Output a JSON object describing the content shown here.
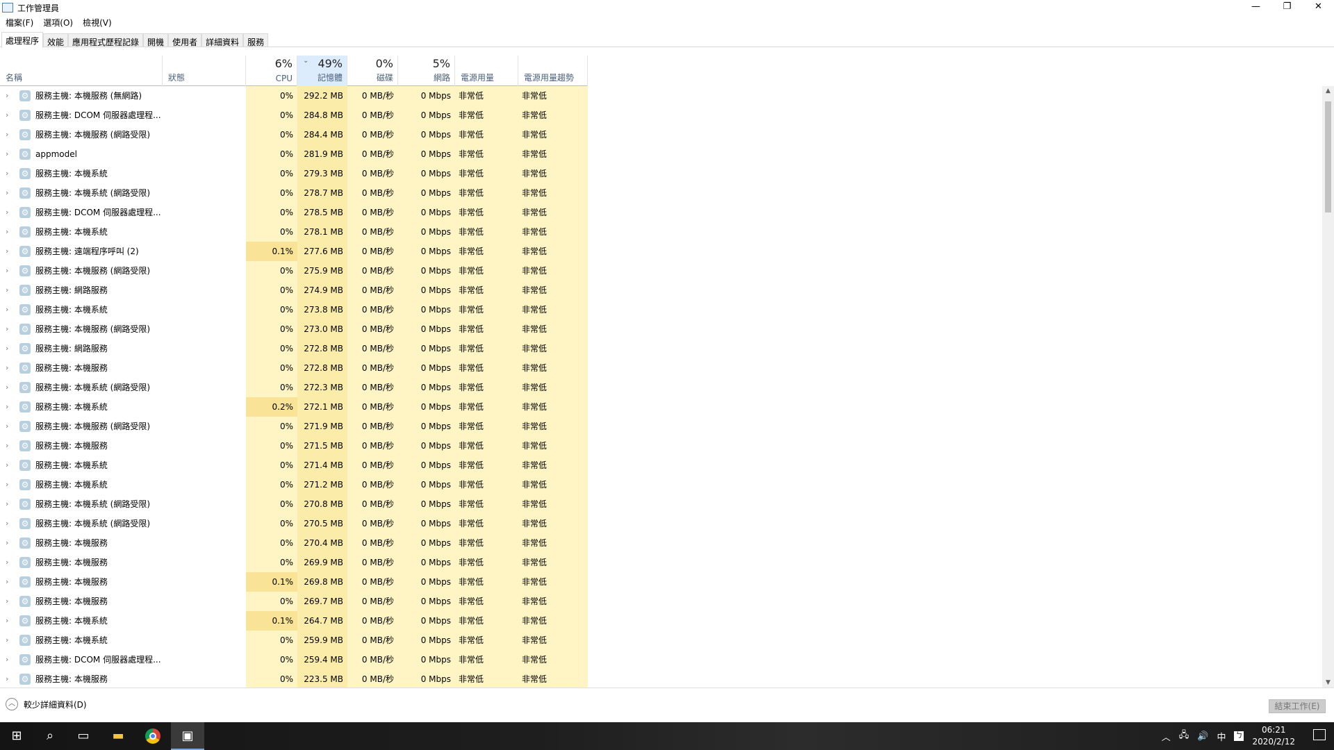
{
  "window": {
    "title": "工作管理員",
    "minimize": "—",
    "maximize": "❐",
    "close": "✕"
  },
  "menu": [
    "檔案(F)",
    "選項(O)",
    "檢視(V)"
  ],
  "tabs": [
    "處理程序",
    "效能",
    "應用程式歷程記錄",
    "開機",
    "使用者",
    "詳細資料",
    "服務"
  ],
  "columns": {
    "name": "名稱",
    "status": "狀態",
    "cpu_pct": "6%",
    "cpu": "CPU",
    "mem_pct": "49%",
    "mem": "記憶體",
    "disk_pct": "0%",
    "disk": "磁碟",
    "net_pct": "5%",
    "net": "網路",
    "power": "電源用量",
    "power_trend": "電源用量趨勢"
  },
  "rows": [
    [
      "服務主機: 本機服務 (無網路)",
      "0%",
      "292.2 MB"
    ],
    [
      "服務主機: DCOM 伺服器處理程...",
      "0%",
      "284.8 MB"
    ],
    [
      "服務主機: 本機服務 (網路受限)",
      "0%",
      "284.4 MB"
    ],
    [
      "appmodel",
      "0%",
      "281.9 MB"
    ],
    [
      "服務主機: 本機系統",
      "0%",
      "279.3 MB"
    ],
    [
      "服務主機: 本機系統 (網路受限)",
      "0%",
      "278.7 MB"
    ],
    [
      "服務主機: DCOM 伺服器處理程...",
      "0%",
      "278.5 MB"
    ],
    [
      "服務主機: 本機系統",
      "0%",
      "278.1 MB"
    ],
    [
      "服務主機: 遠端程序呼叫 (2)",
      "0.1%",
      "277.6 MB"
    ],
    [
      "服務主機: 本機服務 (網路受限)",
      "0%",
      "275.9 MB"
    ],
    [
      "服務主機: 網路服務",
      "0%",
      "274.9 MB"
    ],
    [
      "服務主機: 本機系統",
      "0%",
      "273.8 MB"
    ],
    [
      "服務主機: 本機服務 (網路受限)",
      "0%",
      "273.0 MB"
    ],
    [
      "服務主機: 網路服務",
      "0%",
      "272.8 MB"
    ],
    [
      "服務主機: 本機服務",
      "0%",
      "272.8 MB"
    ],
    [
      "服務主機: 本機系統 (網路受限)",
      "0%",
      "272.3 MB"
    ],
    [
      "服務主機: 本機系統",
      "0.2%",
      "272.1 MB"
    ],
    [
      "服務主機: 本機服務 (網路受限)",
      "0%",
      "271.9 MB"
    ],
    [
      "服務主機: 本機服務",
      "0%",
      "271.5 MB"
    ],
    [
      "服務主機: 本機系統",
      "0%",
      "271.4 MB"
    ],
    [
      "服務主機: 本機系統",
      "0%",
      "271.2 MB"
    ],
    [
      "服務主機: 本機系統 (網路受限)",
      "0%",
      "270.8 MB"
    ],
    [
      "服務主機: 本機系統 (網路受限)",
      "0%",
      "270.5 MB"
    ],
    [
      "服務主機: 本機服務",
      "0%",
      "270.4 MB"
    ],
    [
      "服務主機: 本機服務",
      "0%",
      "269.9 MB"
    ],
    [
      "服務主機: 本機服務",
      "0.1%",
      "269.8 MB"
    ],
    [
      "服務主機: 本機服務",
      "0%",
      "269.7 MB"
    ],
    [
      "服務主機: 本機系統",
      "0.1%",
      "264.7 MB"
    ],
    [
      "服務主機: 本機系統",
      "0%",
      "259.9 MB"
    ],
    [
      "服務主機: DCOM 伺服器處理程...",
      "0%",
      "259.4 MB"
    ],
    [
      "服務主機: 本機服務",
      "0%",
      "223.5 MB"
    ]
  ],
  "row_defaults": {
    "disk": "0 MB/秒",
    "net": "0 Mbps",
    "power": "非常低",
    "power_trend": "非常低"
  },
  "footer": {
    "fewer_details": "較少詳細資料(D)",
    "end_task": "結束工作(E)"
  },
  "taskbar": {
    "tray_ime": "中",
    "time": "06:21",
    "date": "2020/2/12"
  },
  "colors": {
    "heat": "#fff4c4",
    "heat_mem": "#fbecaa",
    "sorted_header": "#dcecfc"
  }
}
